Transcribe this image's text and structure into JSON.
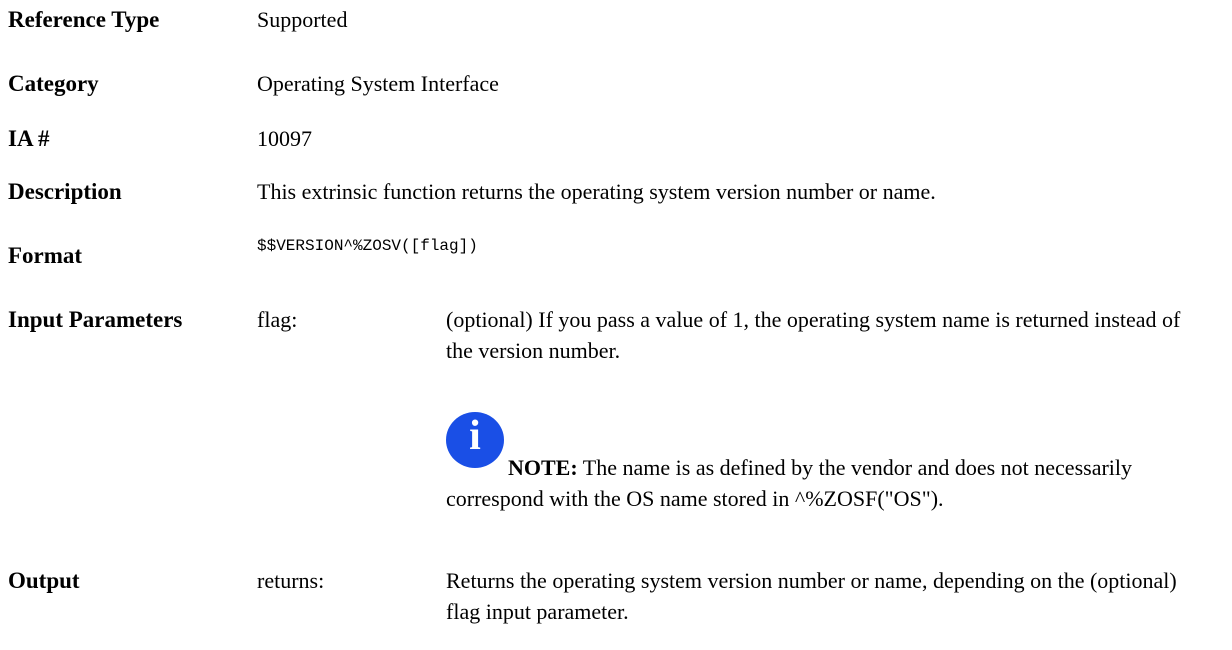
{
  "rows": [
    {
      "label": "Reference Type",
      "value": "Supported"
    },
    {
      "label": "Category",
      "value": "Operating System Interface"
    },
    {
      "label": "IA #",
      "value": "10097"
    },
    {
      "label": "Description",
      "value": "This extrinsic function returns the operating system version number or name."
    },
    {
      "label": "Format",
      "value": "$$VERSION^%ZOSV([flag])"
    }
  ],
  "input_parameters": {
    "label": "Input Parameters",
    "param": "flag:",
    "description": "(optional) If you pass a value of 1, the operating system name is returned instead of the version number.",
    "note": {
      "icon": "info-icon",
      "icon_glyph": "i",
      "label": "NOTE:",
      "text": "The name is as defined by the vendor and does not necessarily correspond with the OS name stored in ^%ZOSF(\"OS\")."
    }
  },
  "output": {
    "label": "Output",
    "param": "returns:",
    "description": "Returns the operating system version number or name, depending on the (optional) flag input parameter."
  }
}
